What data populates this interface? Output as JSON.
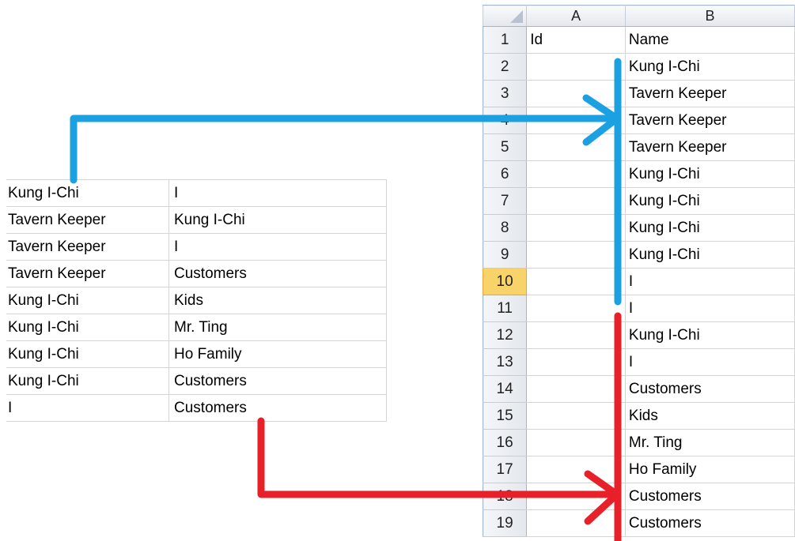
{
  "source_table": {
    "rows": [
      {
        "col1": "Kung I-Chi",
        "col2": "I"
      },
      {
        "col1": "Tavern Keeper",
        "col2": "Kung I-Chi"
      },
      {
        "col1": "Tavern Keeper",
        "col2": "I"
      },
      {
        "col1": "Tavern Keeper",
        "col2": "Customers"
      },
      {
        "col1": "Kung I-Chi",
        "col2": "Kids"
      },
      {
        "col1": "Kung I-Chi",
        "col2": "Mr. Ting"
      },
      {
        "col1": "Kung I-Chi",
        "col2": "Ho Family"
      },
      {
        "col1": "Kung I-Chi",
        "col2": "Customers"
      },
      {
        "col1": "I",
        "col2": "Customers"
      }
    ]
  },
  "spreadsheet": {
    "column_headers": [
      "A",
      "B"
    ],
    "active_row": "10",
    "rows": [
      {
        "num": "1",
        "a": "Id",
        "b": "Name"
      },
      {
        "num": "2",
        "a": "",
        "b": "Kung I-Chi"
      },
      {
        "num": "3",
        "a": "",
        "b": "Tavern Keeper"
      },
      {
        "num": "4",
        "a": "",
        "b": "Tavern Keeper"
      },
      {
        "num": "5",
        "a": "",
        "b": "Tavern Keeper"
      },
      {
        "num": "6",
        "a": "",
        "b": "Kung I-Chi"
      },
      {
        "num": "7",
        "a": "",
        "b": "Kung I-Chi"
      },
      {
        "num": "8",
        "a": "",
        "b": "Kung I-Chi"
      },
      {
        "num": "9",
        "a": "",
        "b": "Kung I-Chi"
      },
      {
        "num": "10",
        "a": "",
        "b": "I"
      },
      {
        "num": "11",
        "a": "",
        "b": "I"
      },
      {
        "num": "12",
        "a": "",
        "b": "Kung I-Chi"
      },
      {
        "num": "13",
        "a": "",
        "b": "I"
      },
      {
        "num": "14",
        "a": "",
        "b": "Customers"
      },
      {
        "num": "15",
        "a": "",
        "b": "Kids"
      },
      {
        "num": "16",
        "a": "",
        "b": "Mr. Ting"
      },
      {
        "num": "17",
        "a": "",
        "b": "Ho Family"
      },
      {
        "num": "18",
        "a": "",
        "b": "Customers"
      },
      {
        "num": "19",
        "a": "",
        "b": "Customers"
      }
    ]
  },
  "annotations": {
    "blue_arrow_color": "#1ba1e2",
    "red_arrow_color": "#e8202a"
  }
}
